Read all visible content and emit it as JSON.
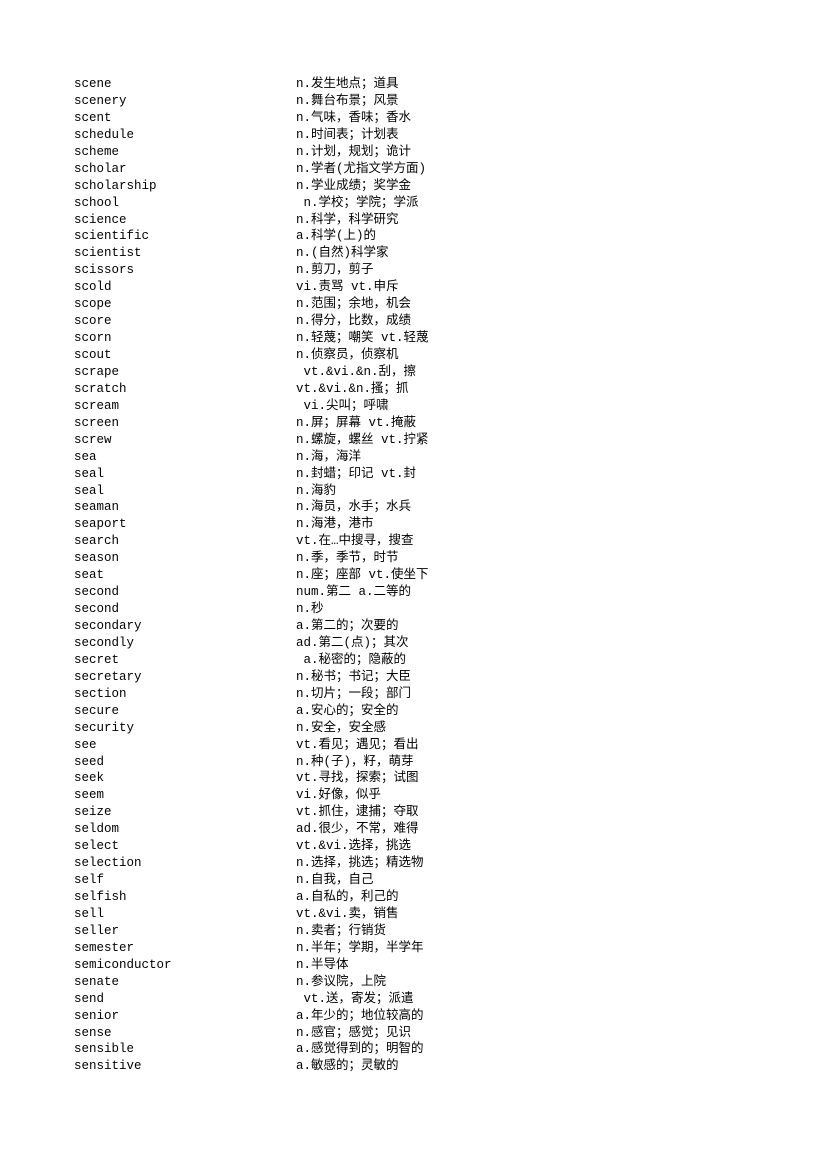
{
  "entries": [
    {
      "word": "scene",
      "definition": "n.发生地点；道具"
    },
    {
      "word": "scenery",
      "definition": "n.舞台布景；风景"
    },
    {
      "word": "scent",
      "definition": "n.气味，香味；香水"
    },
    {
      "word": "schedule",
      "definition": "n.时间表；计划表"
    },
    {
      "word": "scheme",
      "definition": "n.计划，规划；诡计"
    },
    {
      "word": "scholar",
      "definition": "n.学者(尤指文学方面)"
    },
    {
      "word": "scholarship",
      "definition": "n.学业成绩；奖学金"
    },
    {
      "word": "school",
      "definition": " n.学校；学院；学派"
    },
    {
      "word": "science",
      "definition": "n.科学，科学研究"
    },
    {
      "word": "scientific",
      "definition": "a.科学(上)的"
    },
    {
      "word": "scientist",
      "definition": "n.(自然)科学家"
    },
    {
      "word": "scissors",
      "definition": "n.剪刀，剪子"
    },
    {
      "word": "scold",
      "definition": "vi.责骂 vt.申斥"
    },
    {
      "word": "scope",
      "definition": "n.范围；余地，机会"
    },
    {
      "word": "score",
      "definition": "n.得分，比数，成绩"
    },
    {
      "word": "scorn",
      "definition": "n.轻蔑；嘲笑 vt.轻蔑"
    },
    {
      "word": "scout",
      "definition": "n.侦察员，侦察机"
    },
    {
      "word": "scrape",
      "definition": " vt.&vi.&n.刮，擦"
    },
    {
      "word": "scratch",
      "definition": "vt.&vi.&n.搔；抓"
    },
    {
      "word": "scream",
      "definition": " vi.尖叫；呼啸"
    },
    {
      "word": "screen",
      "definition": "n.屏；屏幕 vt.掩蔽"
    },
    {
      "word": "screw",
      "definition": "n.螺旋，螺丝 vt.拧紧"
    },
    {
      "word": "sea",
      "definition": "n.海，海洋"
    },
    {
      "word": "seal",
      "definition": "n.封蜡；印记 vt.封"
    },
    {
      "word": "seal",
      "definition": "n.海豹"
    },
    {
      "word": "seaman",
      "definition": "n.海员，水手；水兵"
    },
    {
      "word": "seaport",
      "definition": "n.海港，港市"
    },
    {
      "word": "search",
      "definition": "vt.在…中搜寻，搜查"
    },
    {
      "word": "season",
      "definition": "n.季，季节，时节"
    },
    {
      "word": "seat",
      "definition": "n.座；座部 vt.使坐下"
    },
    {
      "word": "second",
      "definition": "num.第二 a.二等的"
    },
    {
      "word": "second",
      "definition": "n.秒"
    },
    {
      "word": "secondary",
      "definition": "a.第二的；次要的"
    },
    {
      "word": "secondly",
      "definition": "ad.第二(点)；其次"
    },
    {
      "word": "secret",
      "definition": " a.秘密的；隐蔽的"
    },
    {
      "word": "secretary",
      "definition": "n.秘书；书记；大臣"
    },
    {
      "word": "section",
      "definition": "n.切片；一段；部门"
    },
    {
      "word": "secure",
      "definition": "a.安心的；安全的"
    },
    {
      "word": "security",
      "definition": "n.安全，安全感"
    },
    {
      "word": "see",
      "definition": "vt.看见；遇见；看出"
    },
    {
      "word": "seed",
      "definition": "n.种(子)，籽，萌芽"
    },
    {
      "word": "seek",
      "definition": "vt.寻找，探索；试图"
    },
    {
      "word": "seem",
      "definition": "vi.好像，似乎"
    },
    {
      "word": "seize",
      "definition": "vt.抓住，逮捕；夺取"
    },
    {
      "word": "seldom",
      "definition": "ad.很少，不常，难得"
    },
    {
      "word": "select",
      "definition": "vt.&vi.选择，挑选"
    },
    {
      "word": "selection",
      "definition": "n.选择，挑选；精选物"
    },
    {
      "word": "self",
      "definition": "n.自我，自己"
    },
    {
      "word": "selfish",
      "definition": "a.自私的，利己的"
    },
    {
      "word": "sell",
      "definition": "vt.&vi.卖，销售"
    },
    {
      "word": "seller",
      "definition": "n.卖者；行销货"
    },
    {
      "word": "semester",
      "definition": "n.半年；学期，半学年"
    },
    {
      "word": "semiconductor",
      "definition": "n.半导体"
    },
    {
      "word": "senate",
      "definition": "n.参议院，上院"
    },
    {
      "word": "send",
      "definition": " vt.送，寄发；派遣"
    },
    {
      "word": "senior",
      "definition": "a.年少的；地位较高的"
    },
    {
      "word": "sense",
      "definition": "n.感官；感觉；见识"
    },
    {
      "word": "sensible",
      "definition": "a.感觉得到的；明智的"
    },
    {
      "word": "sensitive",
      "definition": "a.敏感的；灵敏的"
    }
  ]
}
